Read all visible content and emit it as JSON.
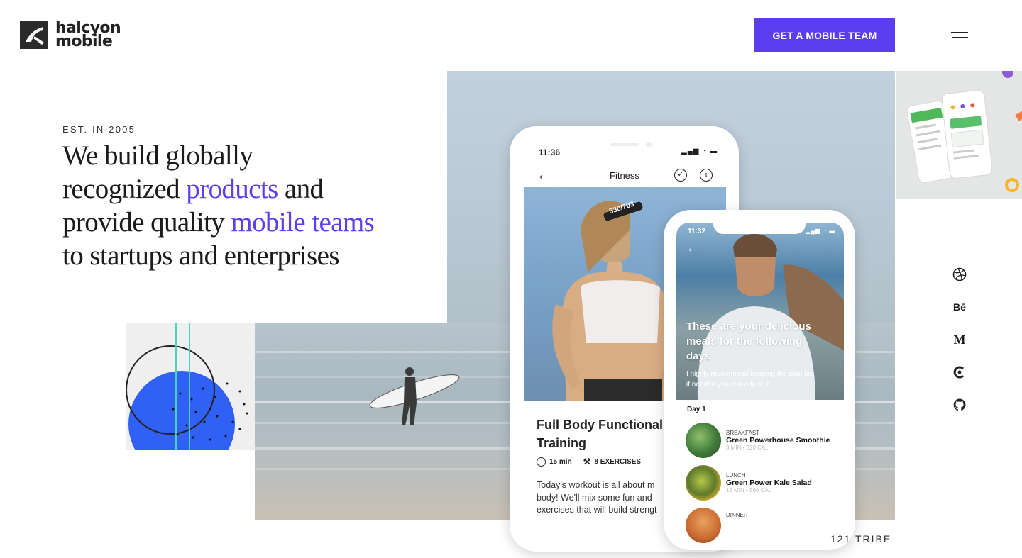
{
  "brand": {
    "line1": "halcyon",
    "line2": "mobile"
  },
  "header": {
    "cta_label": "GET A MOBILE TEAM"
  },
  "hero": {
    "eyebrow": "EST. IN 2005",
    "line1": "We build globally",
    "line2_pre": "recognized ",
    "line2_hl": "products",
    "line2_post": " and",
    "line3_pre": "provide quality ",
    "line3_hl": "mobile teams",
    "line4": "to startups and enterprises"
  },
  "phone_fitness": {
    "time": "11:36",
    "title": "Fitness",
    "headband": "530/703",
    "workout_title_1": "Full Body Functional",
    "workout_title_2": "Training",
    "duration": "15 min",
    "exercises": "8 EXERCISES",
    "desc_1": "Today's workout is all about m",
    "desc_2": "body! We'll mix some fun and",
    "desc_3": "exercises that will build strengt"
  },
  "phone_meals": {
    "time": "11:32",
    "headline_1": "These are your delicious",
    "headline_2": "meals for the following",
    "headline_3": "days",
    "sub_1": "I highly recommend keeping the plan but",
    "sub_2": "if needed you can adjust it.",
    "day": "Day 1",
    "meals": [
      {
        "kind": "BREAKFAST",
        "name": "Green Powerhouse Smoothie",
        "meta": "3 MIN • 320 CAL"
      },
      {
        "kind": "LUNCH",
        "name": "Green Power Kale Salad",
        "meta": "15 MIN • 560 CAL"
      },
      {
        "kind": "DINNER",
        "name": "",
        "meta": ""
      }
    ]
  },
  "social": {
    "behance": "Bē",
    "medium": "M"
  },
  "footer": {
    "project": "121 TRIBE"
  },
  "colors": {
    "accent": "#5a3ef0",
    "dark": "#1b1b1b",
    "circle_blue": "#3060f5",
    "teal": "#4fd1b5"
  },
  "icons": [
    "halcyon-logo-icon",
    "hamburger-menu-icon",
    "dribbble-icon",
    "behance-icon",
    "medium-icon",
    "clutch-icon",
    "github-icon",
    "back-arrow-icon",
    "check-circle-icon",
    "info-icon",
    "clock-icon",
    "dumbbell-icon"
  ]
}
